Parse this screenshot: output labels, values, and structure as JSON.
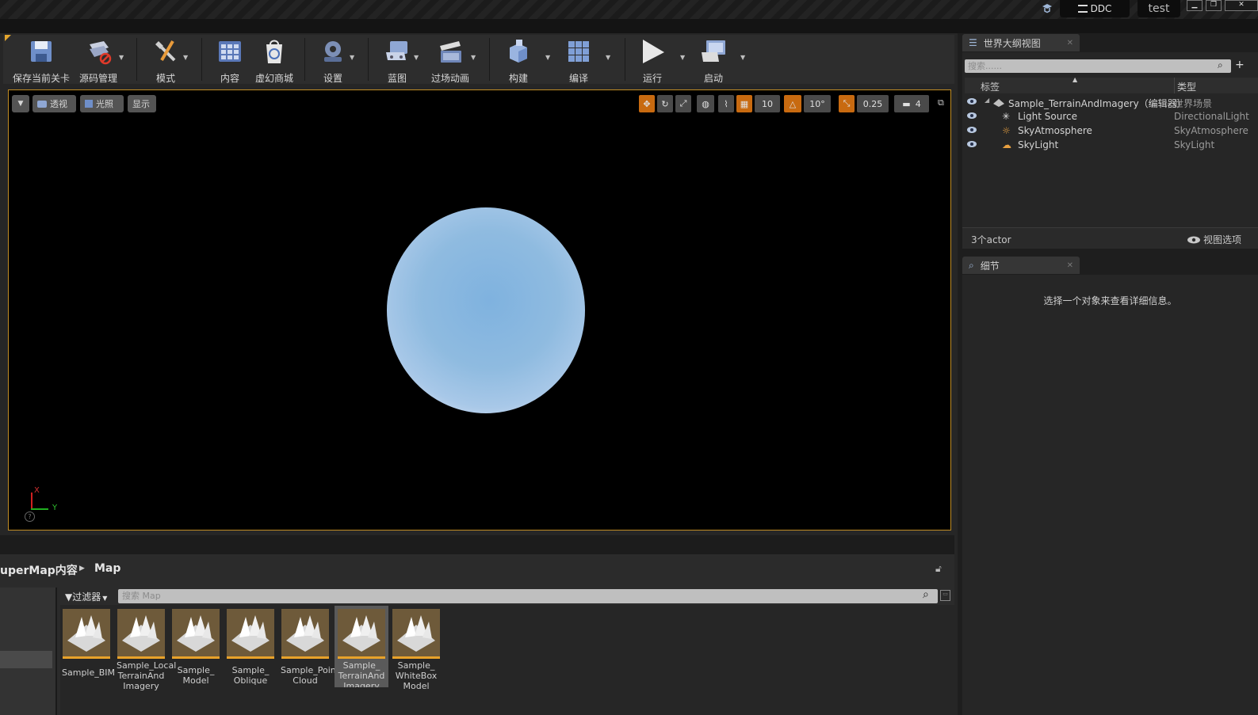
{
  "titlebar": {
    "ddc_label": "DDC",
    "project_label": "test"
  },
  "toolbar": {
    "items": [
      {
        "label": "保存当前关卡",
        "icon": "save-icon"
      },
      {
        "label": "源码管理",
        "icon": "source-control-icon"
      },
      {
        "label": "模式",
        "icon": "modes-icon"
      },
      {
        "label": "内容",
        "icon": "content-icon"
      },
      {
        "label": "虚幻商城",
        "icon": "marketplace-icon"
      },
      {
        "label": "设置",
        "icon": "settings-icon"
      },
      {
        "label": "蓝图",
        "icon": "blueprint-icon"
      },
      {
        "label": "过场动画",
        "icon": "cinematics-icon"
      },
      {
        "label": "构建",
        "icon": "build-icon"
      },
      {
        "label": "编译",
        "icon": "compile-icon"
      },
      {
        "label": "运行",
        "icon": "play-icon"
      },
      {
        "label": "启动",
        "icon": "launch-icon"
      }
    ]
  },
  "viewport": {
    "perspective_label": "透视",
    "lit_label": "光照",
    "show_label": "显示",
    "grid_snap": "10",
    "rotate_snap": "10°",
    "scale_snap": "0.25",
    "camera_speed": "4",
    "axis_x": "X",
    "axis_y": "Y"
  },
  "outliner": {
    "tab_label": "世界大纲视图",
    "search_placeholder": "搜索......",
    "col_label": "标签",
    "col_type": "类型",
    "rows": [
      {
        "label": "Sample_TerrainAndImagery（编辑器）",
        "type": "世界场景"
      },
      {
        "label": "Light Source",
        "type": "DirectionalLight"
      },
      {
        "label": "SkyAtmosphere",
        "type": "SkyAtmosphere"
      },
      {
        "label": "SkyLight",
        "type": "SkyLight"
      }
    ],
    "actor_count": "3个actor",
    "view_options": "视图选项"
  },
  "details": {
    "tab_label": "细节",
    "empty_message": "选择一个对象来查看详细信息。"
  },
  "content_browser": {
    "path_root": "uperMap内容",
    "path_current": "Map",
    "filter_label": "过滤器",
    "search_placeholder": "搜索 Map",
    "assets": [
      {
        "line1": "Sample_BIM",
        "line2": "",
        "line3": ""
      },
      {
        "line1": "Sample_Local",
        "line2": "TerrainAnd",
        "line3": "Imagery"
      },
      {
        "line1": "Sample_",
        "line2": "Model",
        "line3": ""
      },
      {
        "line1": "Sample_",
        "line2": "Oblique",
        "line3": ""
      },
      {
        "line1": "Sample_Point",
        "line2": "Cloud",
        "line3": ""
      },
      {
        "line1": "Sample_",
        "line2": "TerrainAnd",
        "line3": "Imagery"
      },
      {
        "line1": "Sample_",
        "line2": "WhiteBox",
        "line3": "Model"
      }
    ],
    "selected_index": 5
  },
  "colors": {
    "accent": "#e3a52d",
    "active_snap": "#c86a10"
  }
}
